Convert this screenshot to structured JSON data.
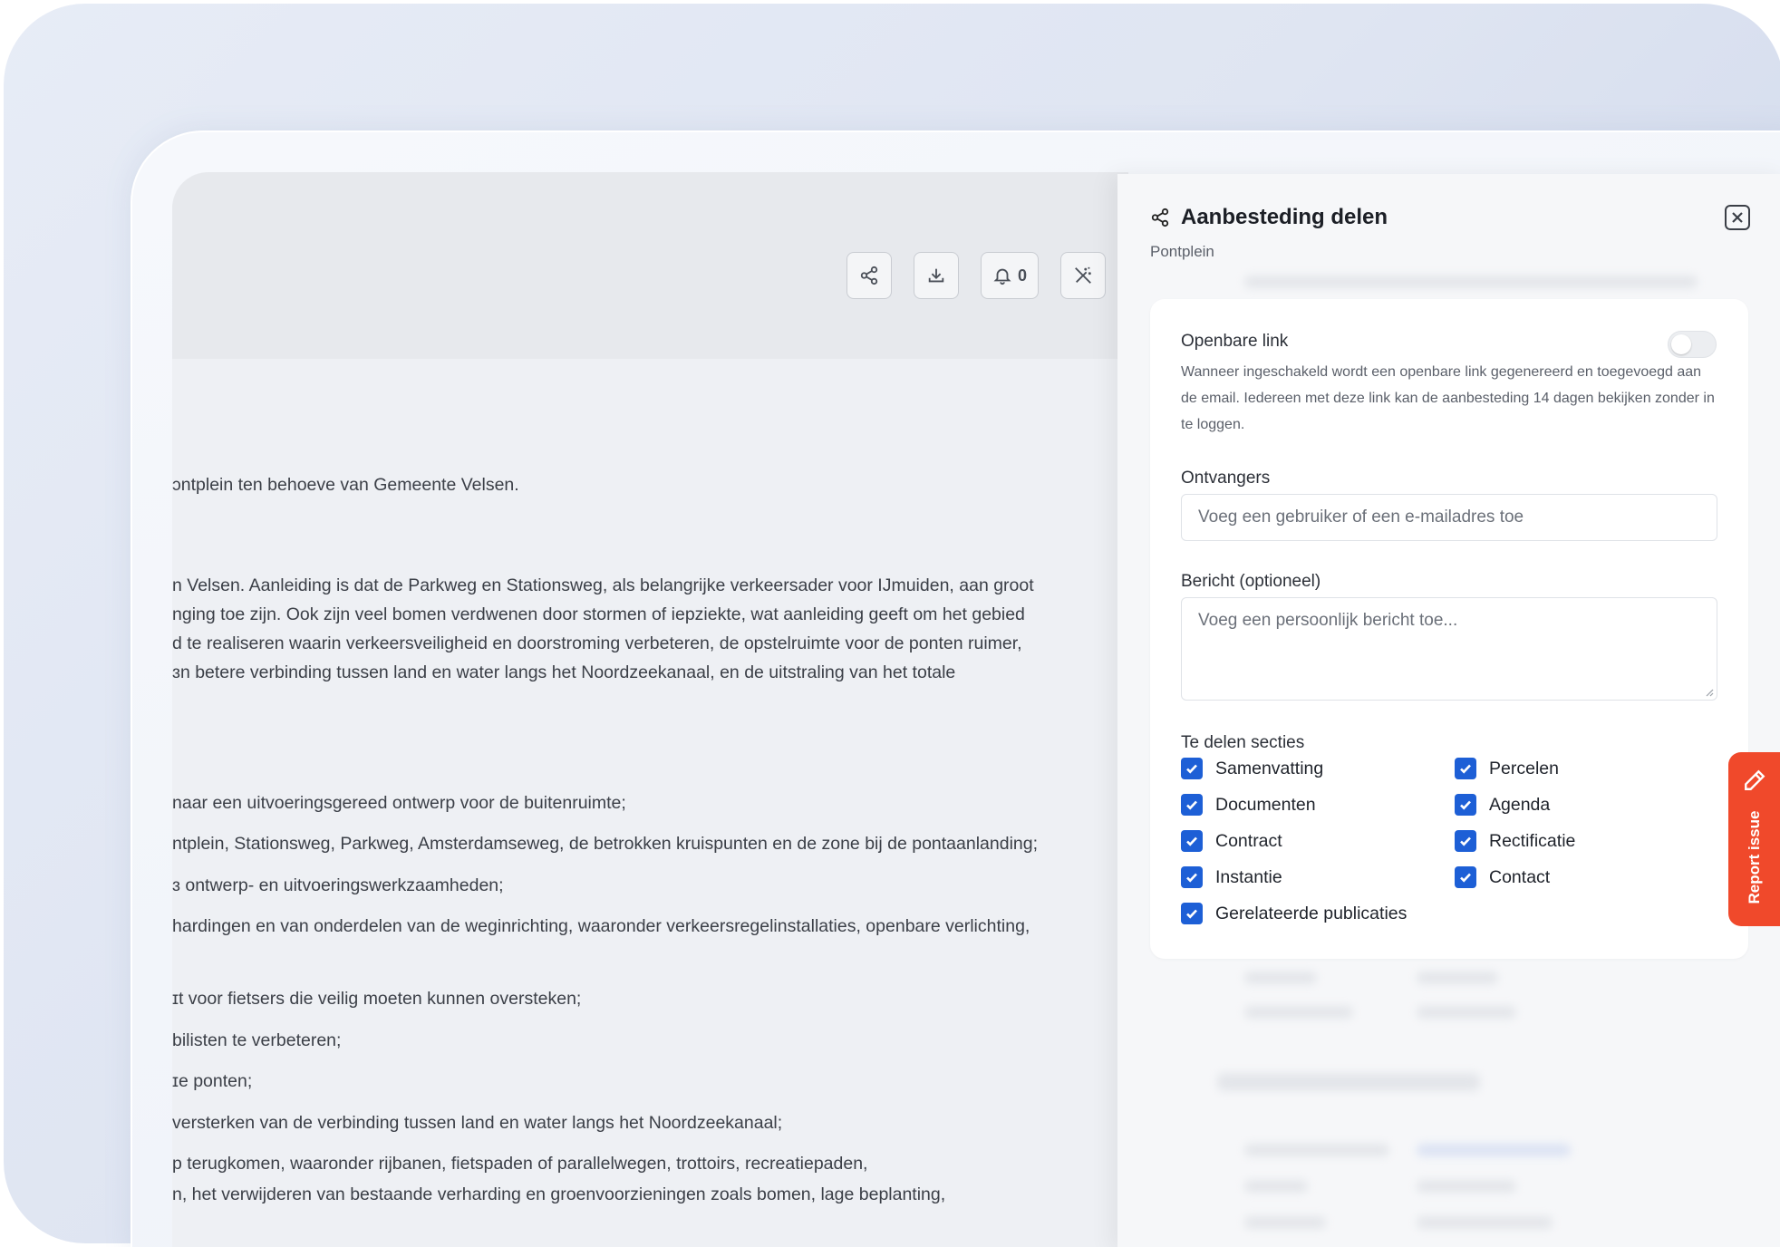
{
  "toolbar": {
    "notifications_count": "0"
  },
  "document": {
    "lines": [
      "ɔntplein ten behoeve van Gemeente Velsen.",
      "n Velsen. Aanleiding is dat de Parkweg en Stationsweg, als belangrijke verkeersader voor IJmuiden, aan groot",
      "nging toe zijn. Ook zijn veel bomen verdwenen door stormen of iepziekte, wat aanleiding geeft om het gebied",
      "d te realiseren waarin verkeersveiligheid en doorstroming verbeteren, de opstelruimte voor de ponten ruimer,",
      "ɜn betere verbinding tussen land en water langs het Noordzeekanaal, en de uitstraling van het totale",
      "naar een uitvoeringsgereed ontwerp voor de buitenruimte;",
      "ntplein, Stationsweg, Parkweg, Amsterdamseweg, de betrokken kruispunten en de zone bij de pontaanlanding;",
      "ɜ ontwerp- en uitvoeringswerkzaamheden;",
      "hardingen en van onderdelen van de weginrichting, waaronder verkeersregelinstallaties, openbare verlichting,",
      "ɪt voor fietsers die veilig moeten kunnen oversteken;",
      "bilisten te verbeteren;",
      "ɪe ponten;",
      "versterken van de verbinding tussen land en water langs het Noordzeekanaal;",
      "p terugkomen, waaronder rijbanen, fietspaden of parallelwegen, trottoirs, recreatiepaden,",
      "n, het verwijderen van bestaande verharding en groenvoorzieningen zoals bomen, lage beplanting,"
    ]
  },
  "panel": {
    "title": "Aanbesteding delen",
    "subtitle": "Pontplein",
    "public_link": {
      "label": "Openbare link",
      "enabled": false,
      "help": "Wanneer ingeschakeld wordt een openbare link gegenereerd en toegevoegd aan de email. Iedereen met deze link kan de aanbesteding 14 dagen bekijken zonder in te loggen."
    },
    "recipients": {
      "label": "Ontvangers",
      "placeholder": "Voeg een gebruiker of een e-mailadres toe"
    },
    "message": {
      "label": "Bericht (optioneel)",
      "placeholder": "Voeg een persoonlijk bericht toe..."
    },
    "sections": {
      "label": "Te delen secties",
      "items": [
        {
          "label": "Samenvatting",
          "checked": true
        },
        {
          "label": "Percelen",
          "checked": true
        },
        {
          "label": "Documenten",
          "checked": true
        },
        {
          "label": "Agenda",
          "checked": true
        },
        {
          "label": "Contract",
          "checked": true
        },
        {
          "label": "Rectificatie",
          "checked": true
        },
        {
          "label": "Instantie",
          "checked": true
        },
        {
          "label": "Contact",
          "checked": true
        },
        {
          "label": "Gerelateerde publicaties",
          "checked": true
        }
      ]
    }
  },
  "report_issue": {
    "label": "Report issue"
  },
  "colors": {
    "accent": "#1d5fd6",
    "report": "#f0492b"
  }
}
